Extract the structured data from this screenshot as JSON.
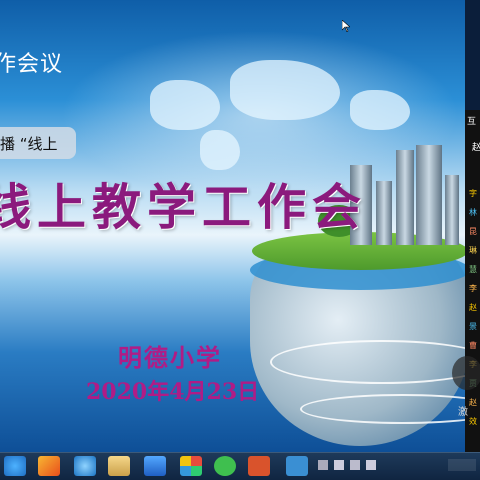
{
  "slide": {
    "meeting_label": "作会议",
    "caption_text": "播 “线上",
    "title": "线上教学工作会",
    "school": "明德小学",
    "date": "2020年4月23日"
  },
  "side_panel": {
    "header": "互",
    "char": "赵",
    "lines": [
      "字",
      "林",
      "昆",
      "琳",
      "慧",
      "李",
      "赵",
      "景",
      "曹",
      "李",
      "贾",
      "赵",
      "效"
    ]
  },
  "float_text": "激",
  "taskbar": {
    "apps": [
      "ie-icon",
      "paint-icon",
      "app-swirl-icon",
      "folder-icon",
      "shield-icon",
      "pinwheel-icon",
      "wechat-icon",
      "ppt-icon",
      "toolbox-icon"
    ]
  },
  "colors": {
    "title": "#8b1a7d",
    "accent": "#b01c86",
    "taskbar": "#1e3a5a"
  }
}
